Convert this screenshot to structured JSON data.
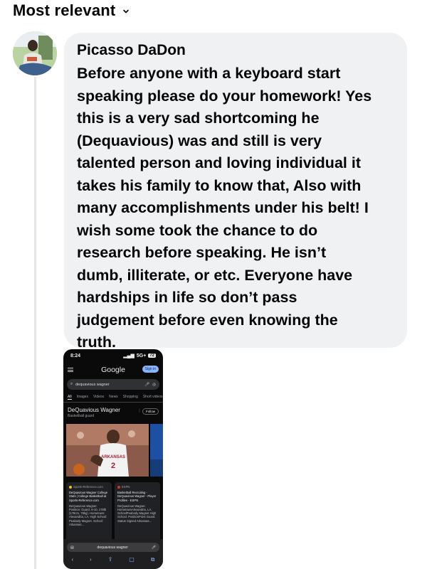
{
  "sort": {
    "label": "Most relevant",
    "chevron": "chevron-down-icon"
  },
  "comment": {
    "author": "Picasso DaDon",
    "lines": [
      "Before anyone with a keyboard start",
      "speaking please do your homework! Yes",
      "this is a very sad shortcoming he",
      "(Dequavious) was and still is very",
      "talented person and loving individual it",
      "takes his family to know that, Also with",
      "many accomplishments under his belt! I",
      "wish some took the chance to do",
      "research before speaking. He isn’t",
      "dumb, illiterate, or etc. Everyone have",
      "hardships in life so don’t pass",
      "judgement before even knowing the",
      "truth."
    ],
    "bubble_color": "#eff1f3"
  },
  "attachment": {
    "status": {
      "time": "8:24",
      "network": "5G+",
      "battery": "72"
    },
    "logo": "Google",
    "signin": "Sign in",
    "query": "dequavious wagner",
    "tabs": [
      "All",
      "Images",
      "Videos",
      "News",
      "Shopping",
      "Short videos"
    ],
    "kp": {
      "title": "DeQuavious Wagner",
      "subtitle": "Basketball guard",
      "follow": "Follow"
    },
    "jersey": "ARKANSAS",
    "cards": [
      {
        "source": "Sports-Reference.com",
        "title": "DeQuavious Wagner College Stats | College Basketball at Sports-Reference.com",
        "snippet": "DeQuavious Wagner. Position: Guard. 6-10, 178lb (178cm, 78kg). Hometown: Alexandria, LA. High School: Peabody Magnet. School: Arkansas..."
      },
      {
        "source": "ESPN",
        "title": "Basketball Recruiting - DeQuavious Wagner - Player Profiles - ESPN",
        "snippet": "DeQuavious Wagner. HometownAlexandria, LA. SchoolPeabody Magnet High School. PositionPoint Guard. Status Signed Arkansas..."
      }
    ],
    "url": "dequavious wagner"
  }
}
